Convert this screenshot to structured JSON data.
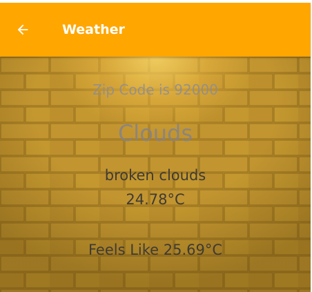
{
  "app_bar": {
    "title": "Weather",
    "back_icon": "arrow-left-icon",
    "background_color": "#ffa600"
  },
  "weather": {
    "zip_label": "Zip Code is 92000",
    "main": "Clouds",
    "description": "broken clouds",
    "temperature": "24.78°C",
    "feels_like": "Feels Like 25.69°C"
  },
  "background": {
    "image": "brick-wall-spotlight"
  }
}
